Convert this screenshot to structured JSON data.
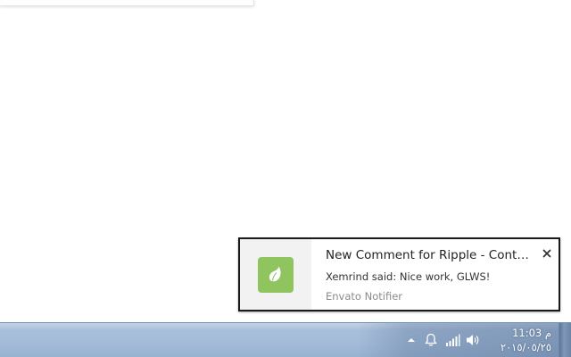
{
  "notification": {
    "title": "New Comment for Ripple - Content Slider...",
    "message": "Xemrind said: Nice work, GLWS!",
    "source": "Envato Notifier",
    "app_icon": "envato-leaf-icon",
    "icon_color": "#8fc45e",
    "close_icon": "close-icon"
  },
  "taskbar": {
    "tray_icons": [
      "chevron-up-icon",
      "bell-icon",
      "signal-bars-icon",
      "speaker-icon"
    ],
    "clock": {
      "time": "11:03 م",
      "date": "٢٠١٥/٠٥/٢٥"
    }
  },
  "colors": {
    "taskbar": "#a3bbd8",
    "toast_border": "#1a1a1a"
  }
}
